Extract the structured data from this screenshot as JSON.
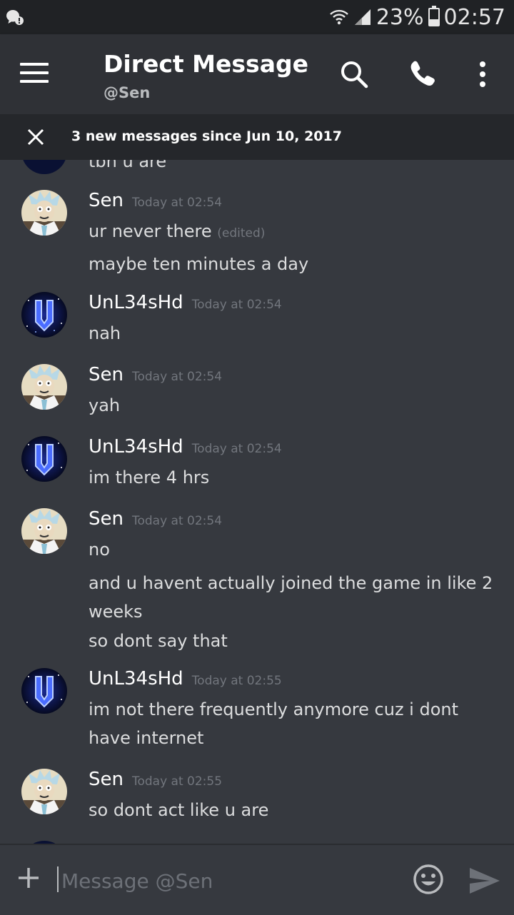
{
  "status_bar": {
    "battery": "23%",
    "time": "02:57"
  },
  "header": {
    "title": "Direct Message",
    "subtitle": "@Sen"
  },
  "banner": {
    "text": "3 new messages since Jun 10, 2017"
  },
  "partial_top_text": "tbh u are",
  "messages": [
    {
      "author": "Sen",
      "timestamp": "Today at 02:54",
      "lines": [
        "ur never there",
        "maybe ten minutes a day"
      ],
      "edited_label": "(edited)"
    },
    {
      "author": "UnL34sHd",
      "timestamp": "Today at 02:54",
      "lines": [
        "nah"
      ]
    },
    {
      "author": "Sen",
      "timestamp": "Today at 02:54",
      "lines": [
        "yah"
      ]
    },
    {
      "author": "UnL34sHd",
      "timestamp": "Today at 02:54",
      "lines": [
        "im there 4 hrs"
      ]
    },
    {
      "author": "Sen",
      "timestamp": "Today at 02:54",
      "lines": [
        "no",
        "and u havent actually joined the game in like 2 weeks",
        "so dont say that"
      ]
    },
    {
      "author": "UnL34sHd",
      "timestamp": "Today at 02:55",
      "lines": [
        "im not there frequently anymore cuz i dont have internet"
      ]
    },
    {
      "author": "Sen",
      "timestamp": "Today at 02:55",
      "lines": [
        "so dont act like u are"
      ]
    }
  ],
  "composer": {
    "placeholder": "Message @Sen"
  },
  "colors": {
    "background": "#36393f",
    "header": "#2f3136",
    "status_bar": "#202225",
    "banner": "#25272b",
    "timestamp": "#72767d"
  }
}
